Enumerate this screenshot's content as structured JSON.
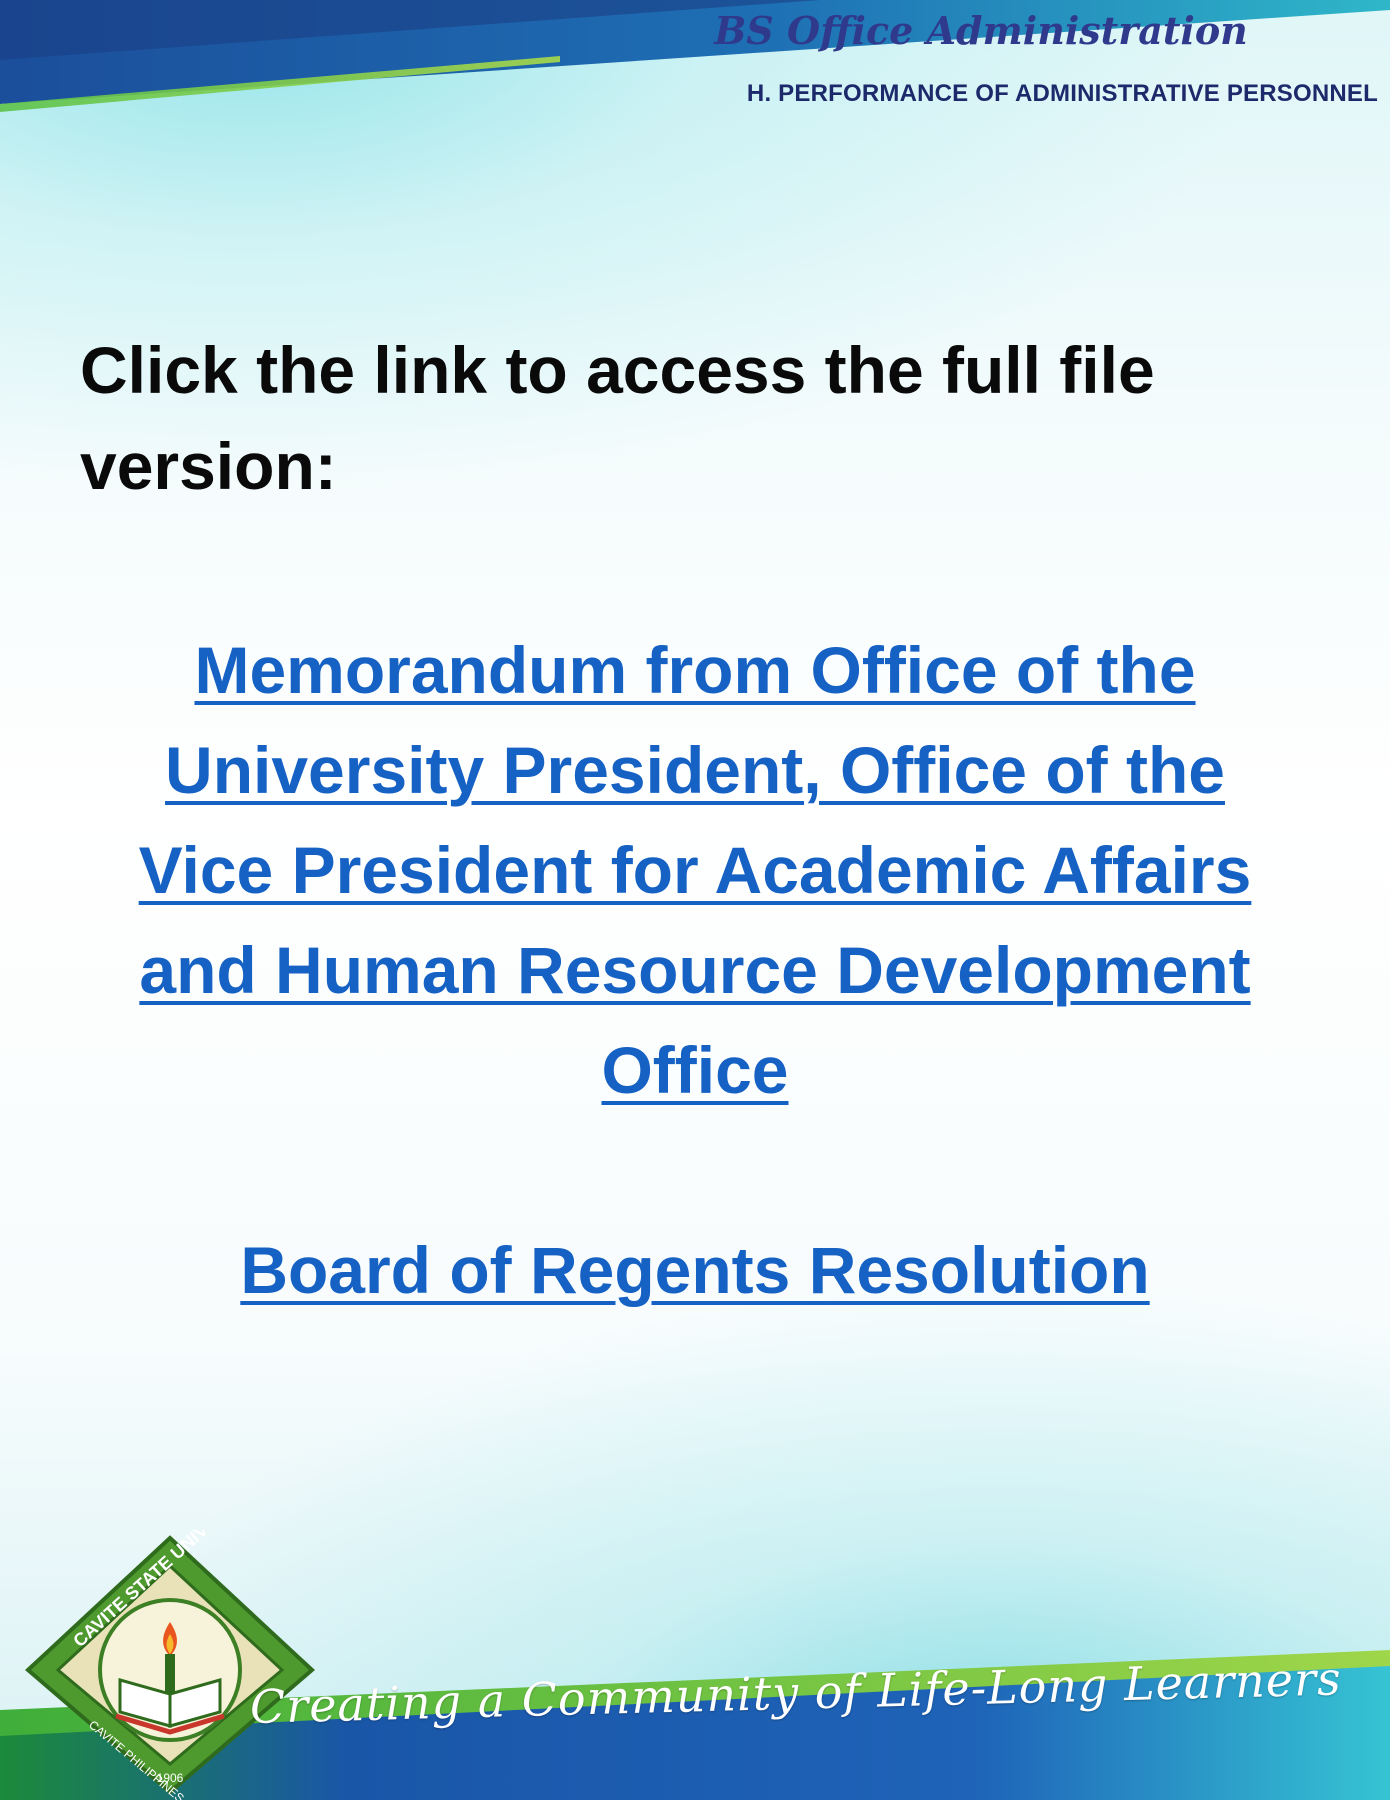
{
  "header": {
    "program_title": "BS Office Administration",
    "section_title": "H. PERFORMANCE OF ADMINISTRATIVE PERSONNEL"
  },
  "main": {
    "instruction": "Click the link to access the full file version:",
    "links": [
      {
        "label": "Memorandum from Office of the University President, Office of the Vice President for Academic Affairs and Human Resource Development Office"
      },
      {
        "label": "Board of Regents Resolution"
      }
    ]
  },
  "footer": {
    "seal_text_top": "CAVITE STATE UNIVERSITY",
    "seal_text_bottom": "CAVITE PHILIPPINES",
    "seal_year": "1906",
    "tagline": "Creating a Community of Life-Long Learners"
  },
  "colors": {
    "link": "#1561c4",
    "header_title": "#2f3a8c",
    "top_band": "#1b4e9b",
    "bottom_band": "#1a56a8",
    "seal_green": "#4e9a2f"
  },
  "icons": {
    "seal": "university-seal-icon"
  }
}
